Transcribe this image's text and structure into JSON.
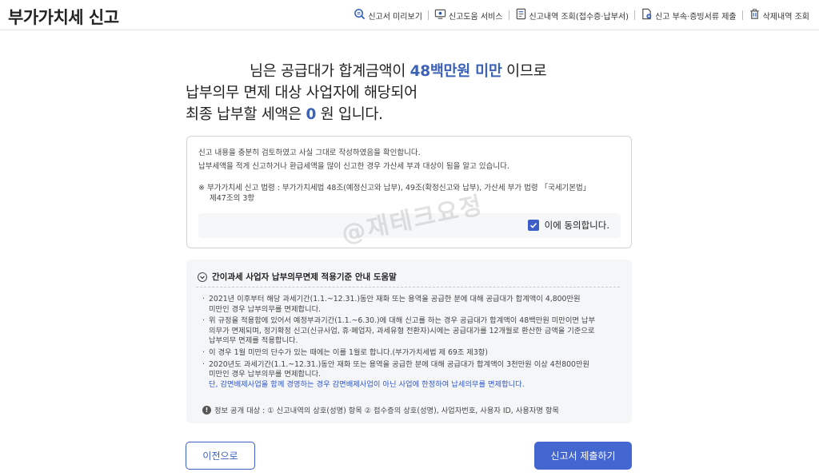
{
  "header": {
    "title": "부가가치세 신고",
    "nav": [
      {
        "label": "신고서 미리보기",
        "icon": "magnifier-doc-icon"
      },
      {
        "label": "신고도움 서비스",
        "icon": "monitor-help-icon"
      },
      {
        "label": "신고내역 조회(접수증·납부서)",
        "icon": "document-list-icon"
      },
      {
        "label": "신고 부속·증빙서류 제출",
        "icon": "document-upload-icon"
      },
      {
        "label": "삭제내역 조회",
        "icon": "trash-icon"
      }
    ]
  },
  "result": {
    "line1_pre": "님은 공급대가 합계금액이 ",
    "line1_highlight": "48백만원 미만",
    "line1_post": " 이므로",
    "line2": "납부의무 면제 대상 사업자에 해당되어",
    "line3_pre": "최종 납부할 세액은 ",
    "line3_value": "0",
    "line3_post": " 원 입니다."
  },
  "confirm": {
    "text1": "신고 내용을 충분히 검토하였고 사실 그대로 작성하였음을 확인합니다.",
    "text2": "납부세액을 적게 신고하거나 환급세액을 많이 신고한 경우 가산세 부과 대상이 됨을 알고 있습니다.",
    "law1": "※ 부가가치세 신고 법령 :  부가가치세법 48조(예정신고와 납부), 49조(확정신고와 납부), 가산세 부가 법령 「국세기본법」",
    "law2": "제47조의 3항",
    "agree_label": "이에 동의합니다.",
    "agree_checked": true
  },
  "watermark": "@재테크요정",
  "guide": {
    "title": "간이과세 사업자 납부의무면제 적용기준 안내 도움말",
    "items": [
      {
        "lines": [
          "2021년 이후부터 해당  과세기간(1.1.~12.31.)동안 재화 또는 용역을 공급한 분에 대해 공급대가 합계액이 4,800만원",
          "미만인 경우 납부의무를 면제합니다."
        ]
      },
      {
        "lines": [
          "위 규정을 적용함에 있어서 예정부과기간(1.1.~6.30.)에 대해 신고를 하는 경우 공급대가 합계액이 48백만원 미만이면 납부",
          "의무가 면제되며, 정기확정 신고(신규사업, 휴·폐업자, 과세유형 전환자)시에는 공급대가를 12개월로 환산한 금액을 기준으로",
          "납부의무 면제를 적용합니다."
        ]
      },
      {
        "lines": [
          "이 경우 1월 미만의 단수가 있는 때에는 이를 1월로 합니다.(부가가치세법 제 69조 제3항)"
        ]
      },
      {
        "lines": [
          "2020년도 과세기간(1.1.~12.31.)동안 재화 또는 용역을 공급한 분에 대해 공급대가 합계액이 3천만원 이상 4천800만원",
          "미만인 경우 납부의무를 면제합니다."
        ],
        "blue": "단, 감면배제사업을 함께 경영하는 경우 감면배제사업이 아닌 사업에 한정하여 납세의무를 면제합니다."
      }
    ],
    "notice": "정보 공개 대상 : ① 신고내역의 상호(성명) 항목 ② 접수증의 상호(성명), 사업자번호, 사용자 ID, 사용자명 항목"
  },
  "buttons": {
    "prev": "이전으로",
    "submit": "신고서 제출하기"
  },
  "colors": {
    "accent": "#4466d0",
    "highlight": "#3c62b7",
    "guide_blue": "#2f56c8"
  }
}
